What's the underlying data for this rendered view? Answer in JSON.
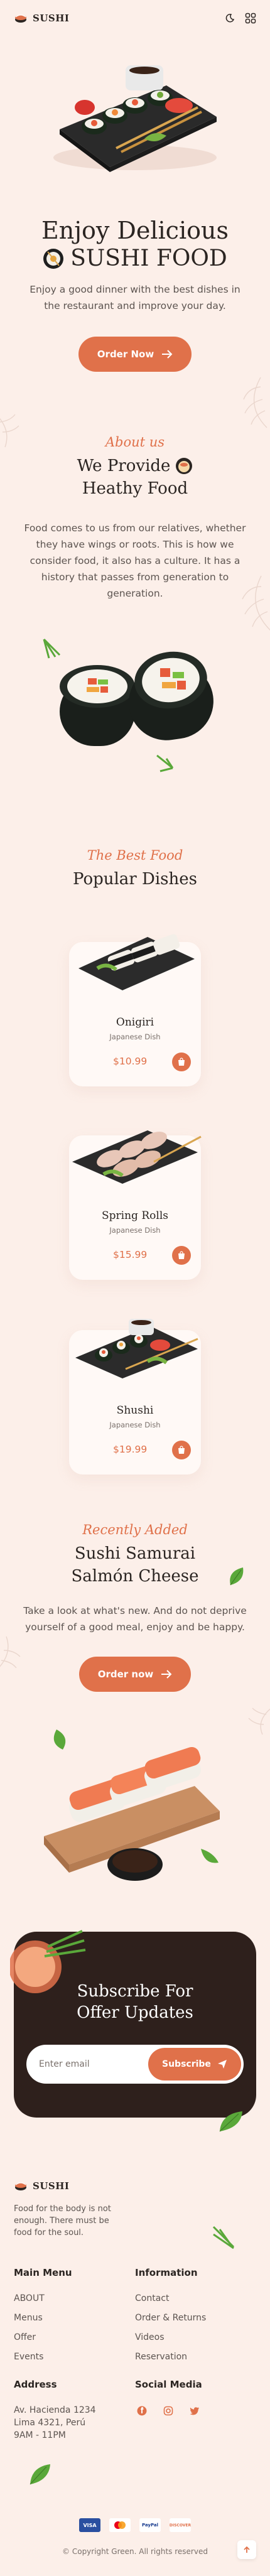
{
  "header": {
    "brand": "SUSHI",
    "icons": [
      "sushi-logo-icon",
      "moon-icon",
      "grid-menu-icon"
    ]
  },
  "hero": {
    "title_line1": "Enjoy Delicious",
    "title_line2": "SUSHI FOOD",
    "description": "Enjoy a good dinner with the best dishes in the restaurant and improve your day.",
    "cta_label": "Order Now"
  },
  "about": {
    "script_label": "About us",
    "title_line1": "We Provide",
    "title_line2": "Heathy Food",
    "description": "Food comes to us from our relatives, whether they have wings or roots. This is how we consider food, it also has a culture. It has a history that passes from generation to generation."
  },
  "popular": {
    "script_label": "The Best Food",
    "title": "Popular Dishes",
    "dishes": [
      {
        "name": "Onigiri",
        "type": "Japanese Dish",
        "price": "$10.99"
      },
      {
        "name": "Spring Rolls",
        "type": "Japanese Dish",
        "price": "$15.99"
      },
      {
        "name": "Shushi",
        "type": "Japanese Dish",
        "price": "$19.99"
      }
    ]
  },
  "recent": {
    "script_label": "Recently Added",
    "title_line1": "Sushi Samurai",
    "title_line2": "Salmón Cheese",
    "description": "Take a look at what's new. And do not deprive yourself of a good meal, enjoy and be happy.",
    "cta_label": "Order now"
  },
  "subscribe": {
    "title_line1": "Subscribe For",
    "title_line2": "Offer Updates",
    "input_placeholder": "Enter email",
    "button_label": "Subscribe"
  },
  "footer": {
    "brand": "SUSHI",
    "tagline": "Food for the body is not enough. There must be food for the soul.",
    "main_menu": {
      "title": "Main Menu",
      "links": [
        "ABOUT",
        "Menus",
        "Offer",
        "Events"
      ]
    },
    "information": {
      "title": "Information",
      "links": [
        "Contact",
        "Order & Returns",
        "Videos",
        "Reservation"
      ]
    },
    "address": {
      "title": "Address",
      "lines": [
        "Av. Hacienda 1234",
        "Lima 4321, Perú",
        "9AM - 11PM"
      ]
    },
    "social": {
      "title": "Social Media",
      "icons": [
        "facebook-icon",
        "instagram-icon",
        "twitter-icon"
      ]
    },
    "payments": [
      "VISA",
      "mastercard",
      "PayPal",
      "DISCOVER"
    ],
    "copyright": "© Copyright Green. All rights reserved"
  },
  "colors": {
    "accent": "#e0714a",
    "background": "#fcefe9",
    "dark": "#2e201c",
    "text": "#2b2522"
  }
}
